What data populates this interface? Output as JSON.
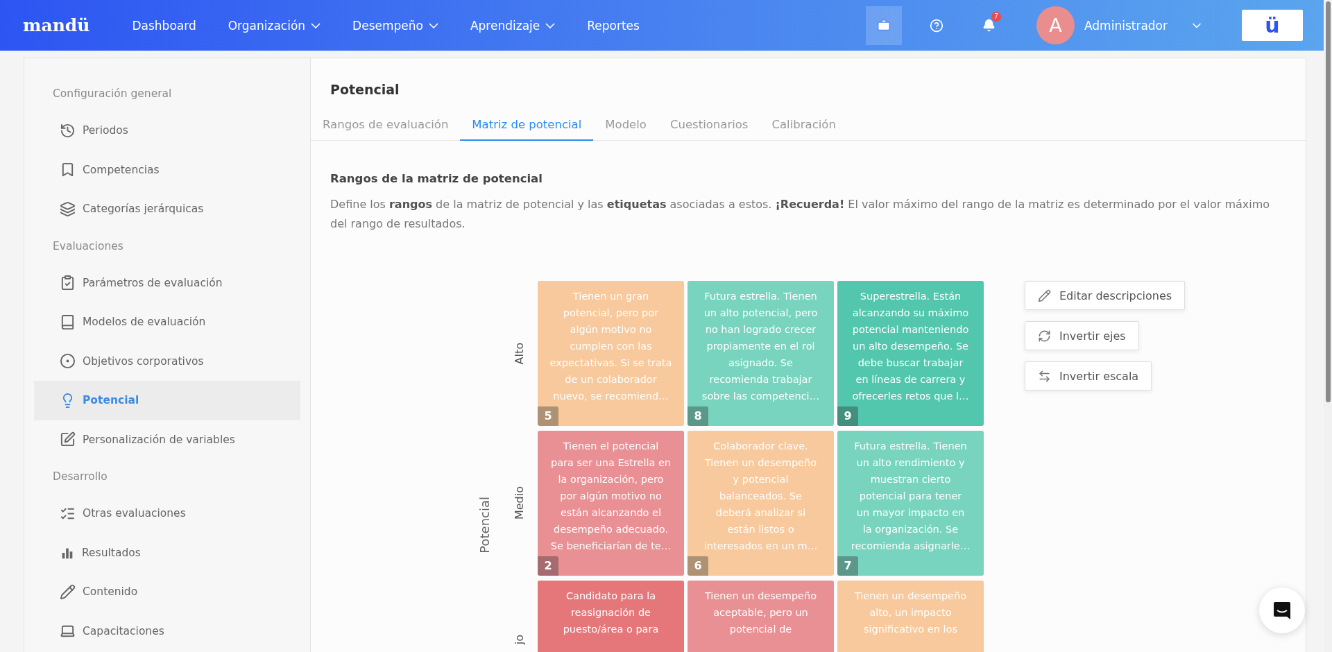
{
  "header": {
    "logo": "mandü",
    "nav": [
      {
        "label": "Dashboard",
        "dropdown": false
      },
      {
        "label": "Organización",
        "dropdown": true
      },
      {
        "label": "Desempeño",
        "dropdown": true
      },
      {
        "label": "Aprendizaje",
        "dropdown": true
      },
      {
        "label": "Reportes",
        "dropdown": false
      }
    ],
    "notification_count": "7",
    "avatar_initial": "A",
    "user": "Administrador",
    "brand_button": "ü"
  },
  "sidebar": {
    "sections": [
      {
        "title": "Configuración general",
        "items": [
          {
            "label": "Periodos",
            "selected": false
          },
          {
            "label": "Competencias",
            "selected": false
          },
          {
            "label": "Categorías jerárquicas",
            "selected": false
          }
        ]
      },
      {
        "title": "Evaluaciones",
        "items": [
          {
            "label": "Parámetros de evaluación",
            "selected": false
          },
          {
            "label": "Modelos de evaluación",
            "selected": false
          },
          {
            "label": "Objetivos corporativos",
            "selected": false
          },
          {
            "label": "Potencial",
            "selected": true
          },
          {
            "label": "Personalización de variables",
            "selected": false
          }
        ]
      },
      {
        "title": "Desarrollo",
        "items": [
          {
            "label": "Otras evaluaciones",
            "selected": false
          },
          {
            "label": "Resultados",
            "selected": false
          },
          {
            "label": "Contenido",
            "selected": false
          },
          {
            "label": "Capacitaciones",
            "selected": false
          }
        ]
      }
    ]
  },
  "page": {
    "title": "Potencial",
    "tabs": [
      {
        "label": "Rangos de evaluación",
        "selected": false
      },
      {
        "label": "Matriz de potencial",
        "selected": true
      },
      {
        "label": "Modelo",
        "selected": false
      },
      {
        "label": "Cuestionarios",
        "selected": false
      },
      {
        "label": "Calibración",
        "selected": false
      }
    ],
    "section_title": "Rangos de la matriz de potencial",
    "description": "Define los **rangos** de la matriz de potencial y las **etiquetas** asociadas a estos. **¡Recuerda!** El valor máximo del rango de la matriz es determinado por el valor máximo del rango de resultados.",
    "matrix": {
      "axis_label": "Potencial",
      "rows": [
        {
          "label": "Alto",
          "cells": [
            {
              "number": "5",
              "color": "#f7c99c",
              "text": "Tienen un gran\npotencial, pero por\nalgún motivo no\ncumplen con las\nexpectativas. Si se trata\nde un colaborador\nnuevo, se recomiend…"
            },
            {
              "number": "8",
              "color": "#78d4bf",
              "text": "Futura estrella. Tienen\nun alto potencial, pero\nno han logrado crecer\npropiamente en el rol\nasignado. Se\nrecomienda trabajar\nsobre las competenci…"
            },
            {
              "number": "9",
              "color": "#52c7ad",
              "text": "Superestrella. Están\nalcanzando su máximo\npotencial manteniendo\nun alto desempeño. Se\ndebe buscar trabajar\nen líneas de carrera y\nofrecerles retos que l…"
            }
          ]
        },
        {
          "label": "Medio",
          "cells": [
            {
              "number": "2",
              "color": "#e89094",
              "text": "Tienen el potencial\npara ser una Estrella en\nla organización, pero\npor algún motivo no\nestán alcanzando el\ndesempeño adecuado.\nSe beneficiarían de te…"
            },
            {
              "number": "6",
              "color": "#f7c99c",
              "text": "Colaborador clave.\nTienen un desempeño\ny potencial\nbalanceados. Se\ndeberá analizar si\nestán listos o\ninteresados en un m…"
            },
            {
              "number": "7",
              "color": "#78d4bf",
              "text": "Futura estrella. Tienen\nun alto rendimiento y\nmuestran cierto\npotencial para tener\nun mayor impacto en\nla organización. Se\nrecomienda asignarle…"
            }
          ]
        },
        {
          "label": "jo",
          "cells": [
            {
              "color": "#e5777a",
              "text": "Candidato para la\nreasignación de\npuesto/área o para"
            },
            {
              "color": "#e89094",
              "text": "Tienen un desempeño\naceptable, pero un\npotencial de"
            },
            {
              "color": "#f7c99c",
              "text": "Tienen un desempeño\nalto, un impacto\nsignificativo en los"
            }
          ]
        }
      ]
    },
    "actions": [
      {
        "label": "Editar descripciones"
      },
      {
        "label": "Invertir ejes"
      },
      {
        "label": "Invertir escala"
      }
    ]
  }
}
